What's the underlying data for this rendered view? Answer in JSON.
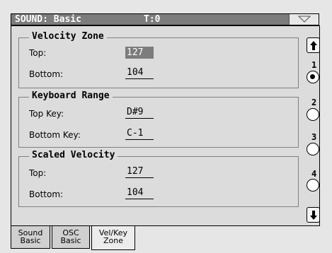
{
  "header": {
    "title": "SOUND: Basic",
    "transpose": "T:0",
    "menu_icon": "triangle-down-icon"
  },
  "velocity_zone": {
    "title": "Velocity Zone",
    "top_label": "Top:",
    "top_value": "127",
    "bottom_label": "Bottom:",
    "bottom_value": "104"
  },
  "keyboard_range": {
    "title": "Keyboard Range",
    "top_label": "Top Key:",
    "top_value": "D#9",
    "bottom_label": "Bottom Key:",
    "bottom_value": "C-1"
  },
  "scaled_velocity": {
    "title": "Scaled Velocity",
    "top_label": "Top:",
    "top_value": "127",
    "bottom_label": "Bottom:",
    "bottom_value": "104"
  },
  "layers": {
    "items": [
      "1",
      "2",
      "3",
      "4"
    ],
    "selected": "1",
    "up_icon": "arrow-up-icon",
    "down_icon": "arrow-down-icon"
  },
  "tabs": [
    {
      "line1": "Sound",
      "line2": "Basic"
    },
    {
      "line1": "OSC",
      "line2": "Basic"
    },
    {
      "line1": "Vel/Key",
      "line2": "Zone"
    }
  ],
  "active_tab": "Vel/Key Zone"
}
